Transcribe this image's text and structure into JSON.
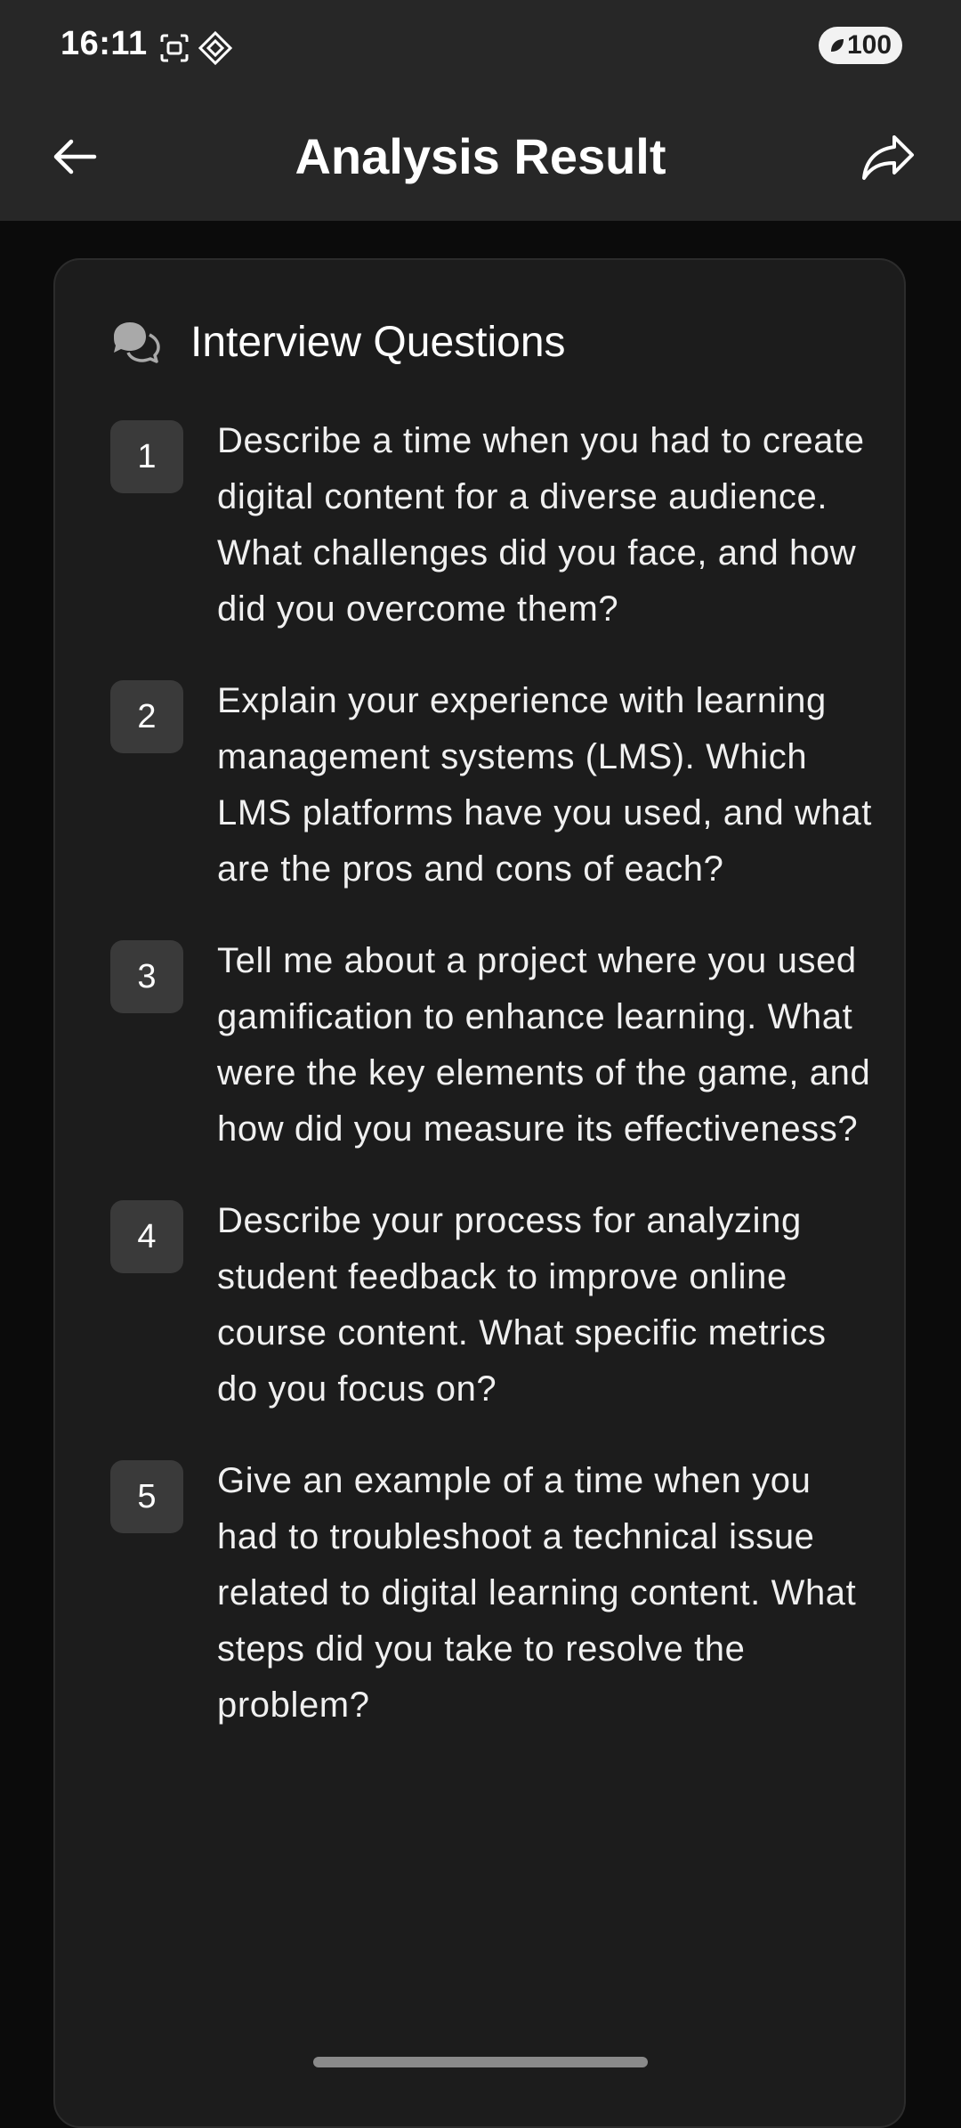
{
  "status_bar": {
    "time": "16:11",
    "battery": "100"
  },
  "app_bar": {
    "title": "Analysis Result"
  },
  "card": {
    "title": "Interview Questions",
    "questions": [
      {
        "number": "1",
        "text": "Describe a time when you had to create digital content for a diverse audience. What challenges did you face, and how did you overcome them?"
      },
      {
        "number": "2",
        "text": "Explain your experience with learning management systems (LMS). Which LMS platforms have you used, and what are the pros and cons of each?"
      },
      {
        "number": "3",
        "text": "Tell me about a project where you used gamification to enhance learning. What were the key elements of the game, and how did you measure its effectiveness?"
      },
      {
        "number": "4",
        "text": "Describe your process for analyzing student feedback to improve online course content. What specific metrics do you focus on?"
      },
      {
        "number": "5",
        "text": "Give an example of a time when you had to troubleshoot a technical issue related to digital learning content. What steps did you take to resolve the problem?"
      }
    ]
  },
  "icons": {
    "back": "arrow-left-icon",
    "share": "share-icon",
    "chat": "chat-bubbles-icon",
    "screenshot": "screenshot-icon",
    "notification": "diamond-notification-icon",
    "battery_leaf": "leaf-icon"
  },
  "colors": {
    "background": "#0b0b0b",
    "bar": "#272727",
    "card": "#1c1c1c",
    "badge": "#3a3a3a",
    "text": "#f0f0f0"
  }
}
